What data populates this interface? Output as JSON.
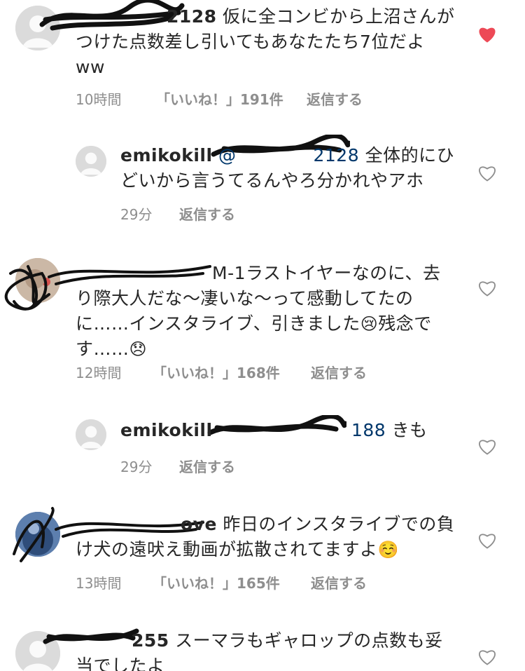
{
  "comments": [
    {
      "user_visible": "2128",
      "text": "仮に全コンビから上沼さんがつけた点数差し引いてもあなたたち7位だよww",
      "line1": "仮に全コンビから上沼さんが",
      "line2": "つけた点数差し引いてもあなたたち7位だよ",
      "line3": "ww",
      "time": "10時間",
      "likes": "「いいね！」191件",
      "reply": "返信する",
      "liked": true
    },
    {
      "user": "emikokill",
      "mention_visible": "@",
      "mention_tail": "2128",
      "line1": "全体的にひ",
      "line2": "どいから言うてるんやろ分かれやアホ",
      "time": "29分",
      "reply": "返信する",
      "liked": false
    },
    {
      "user_visible": "M-1",
      "line1": "ラストイヤーなのに、去",
      "line2": "り際大人だな〜凄いな〜って感動してたの",
      "line3": "に……インスタライブ、引きました",
      "emoji1": "😢",
      "line3b": "残念で",
      "line4": "す……",
      "emoji2": "😞",
      "time": "12時間",
      "likes": "「いいね！」168件",
      "reply": "返信する",
      "liked": false
    },
    {
      "user": "emikokill",
      "mention_tail": "188",
      "line1": "きも",
      "time": "29分",
      "reply": "返信する",
      "liked": false
    },
    {
      "user_visible": "ove",
      "line1": "昨日のインスタライブでの負",
      "line2": "け犬の遠吠え動画が拡散されてますよ",
      "emoji1": "☺️",
      "time": "13時間",
      "likes": "「いいね！」165件",
      "reply": "返信する",
      "liked": false
    },
    {
      "user_visible": "255",
      "line1": "スーマラもギャロップの点数も妥",
      "line2": "当でしたよ",
      "liked": false
    }
  ],
  "colors": {
    "text": "#262626",
    "meta": "#8e8e8e",
    "mention": "#00376b",
    "heart_filled": "#ed4956",
    "heart_outline": "#8e8e8e"
  },
  "icons": {
    "heart_filled": "heart-filled-icon",
    "heart_outline": "heart-outline-icon",
    "avatar_placeholder": "default-avatar-icon"
  }
}
